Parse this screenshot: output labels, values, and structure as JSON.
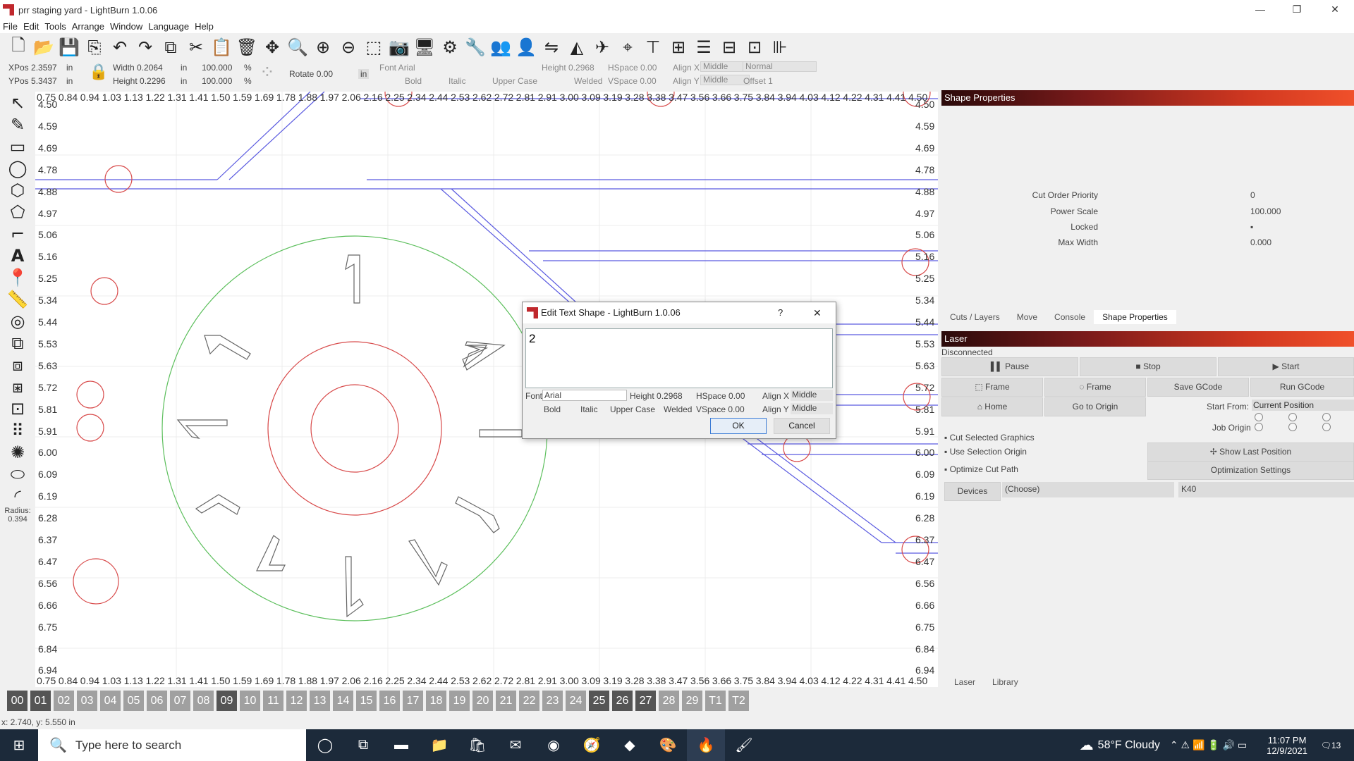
{
  "window": {
    "title": "prr staging yard - LightBurn 1.0.06",
    "minimize": "—",
    "maximize": "❐",
    "close": "✕"
  },
  "menu": [
    "File",
    "Edit",
    "Tools",
    "Arrange",
    "Window",
    "Language",
    "Help"
  ],
  "propbar": {
    "xpos": "XPos 2.3597",
    "ypos": "YPos 5.3437",
    "unit1": "in",
    "unit2": "in",
    "width": "Width 0.2064",
    "height": "Height 0.2296",
    "unit3": "in",
    "unit4": "in",
    "scale_w": "100.000",
    "scale_h": "100.000",
    "pct1": "%",
    "pct2": "%",
    "rotate": "Rotate 0.00",
    "rot_unit": "in",
    "font": "Font Arial",
    "text_height": "Height 0.2968",
    "hspace": "HSpace 0.00",
    "vspace": "VSpace 0.00",
    "bold": "Bold",
    "italic": "Italic",
    "upper": "Upper Case",
    "welded": "Welded",
    "alignx": "Align X",
    "aligny": "Align Y",
    "alignx_val": "Middle",
    "aligny_val": "Middle",
    "normal": "Normal",
    "offset": "Offset 1"
  },
  "radius": {
    "label": "Radius:",
    "value": "0.394"
  },
  "ruler_top": [
    "0.75",
    "0.84",
    "0.94",
    "1.03",
    "1.13",
    "1.22",
    "1.31",
    "1.41",
    "1.50",
    "1.59",
    "1.69",
    "1.78",
    "1.88",
    "1.97",
    "2.06",
    "2.16",
    "2.25",
    "2.34",
    "2.44",
    "2.53",
    "2.62",
    "2.72",
    "2.81",
    "2.91",
    "3.00",
    "3.09",
    "3.19",
    "3.28",
    "3.38",
    "3.47",
    "3.56",
    "3.66",
    "3.75",
    "3.84",
    "3.94",
    "4.03",
    "4.12",
    "4.22",
    "4.31",
    "4.41",
    "4.50"
  ],
  "ruler_side": [
    "4.50",
    "4.59",
    "4.69",
    "4.78",
    "4.88",
    "4.97",
    "5.06",
    "5.16",
    "5.25",
    "5.34",
    "5.44",
    "5.53",
    "5.63",
    "5.72",
    "5.81",
    "5.91",
    "6.00",
    "6.09",
    "6.19",
    "6.28",
    "6.37",
    "6.47",
    "6.56",
    "6.66",
    "6.75",
    "6.84",
    "6.94"
  ],
  "canvas_text": {
    "n1": "1",
    "n2": "2",
    "n3": "7"
  },
  "palette": [
    "00",
    "01",
    "02",
    "03",
    "04",
    "05",
    "06",
    "07",
    "08",
    "09",
    "10",
    "11",
    "12",
    "13",
    "14",
    "15",
    "16",
    "17",
    "18",
    "19",
    "20",
    "21",
    "22",
    "23",
    "24",
    "25",
    "26",
    "27",
    "28",
    "29",
    "T1",
    "T2"
  ],
  "status": "x: 2.740, y: 5.550 in",
  "shape_props": {
    "title": "Shape Properties",
    "cut_order": "Cut Order Priority",
    "cut_order_val": "0",
    "power_scale": "Power Scale",
    "power_scale_val": "100.000",
    "locked": "Locked",
    "max_width": "Max Width",
    "max_width_val": "0.000"
  },
  "tabs1": [
    "Cuts / Layers",
    "Move",
    "Console",
    "Shape Properties"
  ],
  "laser": {
    "title": "Laser",
    "status": "Disconnected",
    "pause": "Pause",
    "stop": "Stop",
    "start": "Start",
    "frame1": "Frame",
    "frame2": "Frame",
    "save_gcode": "Save GCode",
    "run_gcode": "Run GCode",
    "home": "Home",
    "go_origin": "Go to Origin",
    "start_from": "Start From:",
    "start_from_val": "Current Position",
    "job_origin": "Job Origin",
    "cut_selected": "Cut Selected Graphics",
    "use_selection": "Use Selection Origin",
    "show_last": "Show Last Position",
    "optimize": "Optimize Cut Path",
    "opt_settings": "Optimization Settings",
    "devices": "Devices",
    "choose": "(Choose)",
    "k40": "K40"
  },
  "tabs2": [
    "Laser",
    "Library"
  ],
  "dialog": {
    "title": "Edit Text Shape - LightBurn 1.0.06",
    "help": "?",
    "close": "✕",
    "text": "2",
    "font_label": "Font",
    "font_val": "Arial",
    "height": "Height 0.2968",
    "hspace": "HSpace 0.00",
    "vspace": "VSpace 0.00",
    "alignx": "Align X",
    "alignx_val": "Middle",
    "aligny": "Align Y",
    "aligny_val": "Middle",
    "bold": "Bold",
    "italic": "Italic",
    "upper": "Upper Case",
    "welded": "Welded",
    "ok": "OK",
    "cancel": "Cancel"
  },
  "taskbar": {
    "search": "Type here to search",
    "weather": "58°F  Cloudy",
    "time": "11:07 PM",
    "date": "12/9/2021",
    "notif": "13"
  }
}
